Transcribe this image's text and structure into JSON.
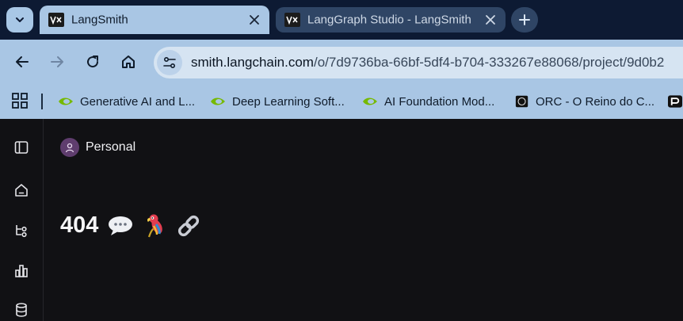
{
  "browser": {
    "tabs": [
      {
        "title": "LangSmith",
        "active": true
      },
      {
        "title": "LangGraph Studio - LangSmith",
        "active": false
      }
    ],
    "address": {
      "host": "smith.langchain.com",
      "path": "/o/7d9736ba-66bf-5df4-b704-333267e88068/project/9d0b2"
    },
    "bookmarks": [
      {
        "label": "Generative AI and L...",
        "icon": "nvidia-icon"
      },
      {
        "label": "Deep Learning Soft...",
        "icon": "nvidia-icon"
      },
      {
        "label": "AI Foundation Mod...",
        "icon": "nvidia-icon"
      },
      {
        "label": "ORC - O Reino do C...",
        "icon": "orc-icon"
      }
    ],
    "colors": {
      "tabstrip": "#0d1a33",
      "toolbar": "#a9c6e4",
      "app_bg": "#111114"
    }
  },
  "app": {
    "workspace": "Personal",
    "error": {
      "code": "404",
      "emojis": [
        "speech-balloon-icon",
        "parrot-icon",
        "link-icon"
      ]
    },
    "sidebar_icons": [
      "panel-toggle-icon",
      "home-icon",
      "hierarchy-icon",
      "chart-icon",
      "database-icon"
    ]
  }
}
